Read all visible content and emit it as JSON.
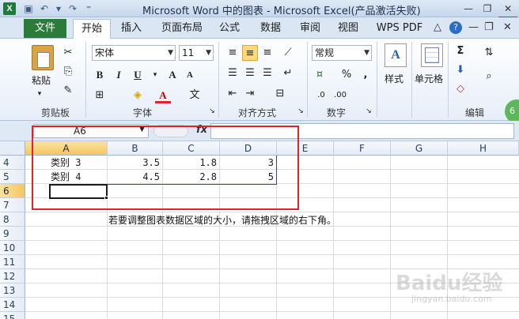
{
  "window": {
    "title": "Microsoft Word 中的图表 - Microsoft Excel(产品激活失败)",
    "app_icon": "X"
  },
  "tabs": {
    "file": "文件",
    "items": [
      "开始",
      "插入",
      "页面布局",
      "公式",
      "数据",
      "审阅",
      "视图",
      "WPS PDF"
    ],
    "active_index": 0
  },
  "ribbon": {
    "clipboard": {
      "label": "剪贴板",
      "paste": "粘贴"
    },
    "font": {
      "label": "字体",
      "name": "宋体",
      "size": "11",
      "bold": "B",
      "italic": "I",
      "underline": "U",
      "font_color": "A"
    },
    "alignment": {
      "label": "对齐方式"
    },
    "number": {
      "label": "数字",
      "format": "常规",
      "percent": "%",
      "comma": ","
    },
    "styles": {
      "label": "样式"
    },
    "cells": {
      "label": "单元格"
    },
    "editing": {
      "label": "编辑",
      "sum": "Σ"
    }
  },
  "formula_bar": {
    "name_box": "A6",
    "fx": "fx",
    "formula": ""
  },
  "sheet": {
    "columns": [
      "A",
      "B",
      "C",
      "D",
      "E",
      "F",
      "G",
      "H"
    ],
    "rows": [
      "4",
      "5",
      "6",
      "7",
      "8",
      "9",
      "10",
      "11",
      "12",
      "13",
      "14",
      "15"
    ],
    "data": [
      [
        "类别 3",
        "3.5",
        "1.8",
        "3"
      ],
      [
        "类别 4",
        "4.5",
        "2.8",
        "5"
      ]
    ],
    "note": "若要调整图表数据区域的大小，请拖拽区域的右下角。"
  },
  "overlay": {
    "badge": "6",
    "watermark": "Baidu经验",
    "watermark_sub": "jingyan.baidu.com"
  },
  "colors": {
    "file_tab": "#2b7b3b",
    "highlight": "#e0232a",
    "selection": "#f5c661"
  }
}
